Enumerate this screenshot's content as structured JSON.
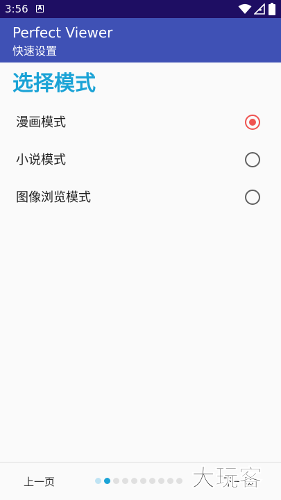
{
  "status_bar": {
    "time": "3:56",
    "notification_glyph": "A"
  },
  "app_bar": {
    "title": "Perfect Viewer",
    "subtitle": "快速设置"
  },
  "main": {
    "section_title": "选择模式",
    "options": [
      {
        "label": "漫画模式",
        "selected": true
      },
      {
        "label": "小说模式",
        "selected": false
      },
      {
        "label": "图像浏览模式",
        "selected": false
      }
    ]
  },
  "bottom_nav": {
    "prev_label": "上一页",
    "next_label": "下一页",
    "page_count": 10,
    "current_page": 2
  },
  "watermark": {
    "text": "大玩客"
  },
  "colors": {
    "status_bar": "#1e0e63",
    "app_bar": "#3f51b5",
    "accent": "#1ba3d6",
    "radio_selected": "#ef5350"
  }
}
